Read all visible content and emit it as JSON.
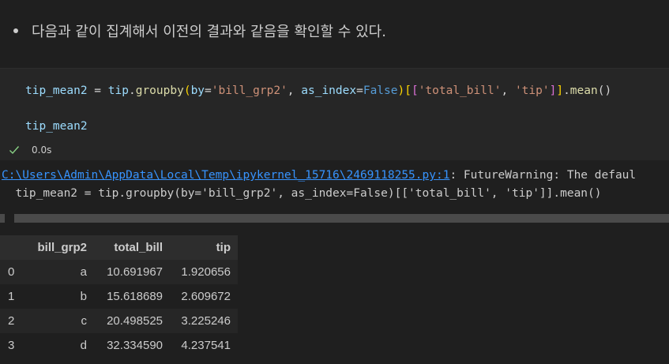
{
  "markdown": {
    "text": "다음과 같이 집계해서 이전의 결과와 같음을 확인할 수 있다."
  },
  "code": {
    "line1": {
      "var": "tip_mean2",
      "assign": " = ",
      "obj": "tip",
      "dot1": ".",
      "func": "groupby",
      "open": "(",
      "kw1": "by",
      "eq1": "=",
      "str1": "'bill_grp2'",
      "comma1": ", ",
      "kw2": "as_index",
      "eq2": "=",
      "const": "False",
      "close": ")",
      "b2open": "[",
      "b3open": "[",
      "str2": "'total_bill'",
      "comma2": ", ",
      "str3": "'tip'",
      "b3close": "]",
      "b2close": "]",
      "dot2": ".",
      "func2": "mean",
      "call": "()"
    },
    "line3": "tip_mean2"
  },
  "status": {
    "icon": "check-icon",
    "time": "0.0s",
    "color": "#89d185"
  },
  "output": {
    "warning_link": "C:\\Users\\Admin\\AppData\\Local\\Temp\\ipykernel_15716\\2469118255.py:1",
    "warning_text": ": FutureWarning: The defaul",
    "warning_code": "  tip_mean2 = tip.groupby(by='bill_grp2', as_index=False)[['total_bill', 'tip']].mean()"
  },
  "table": {
    "columns": [
      "",
      "bill_grp2",
      "total_bill",
      "tip"
    ],
    "rows": [
      [
        "0",
        "a",
        "10.691967",
        "1.920656"
      ],
      [
        "1",
        "b",
        "15.618689",
        "2.609672"
      ],
      [
        "2",
        "c",
        "20.498525",
        "3.225246"
      ],
      [
        "3",
        "d",
        "32.334590",
        "4.237541"
      ]
    ]
  }
}
